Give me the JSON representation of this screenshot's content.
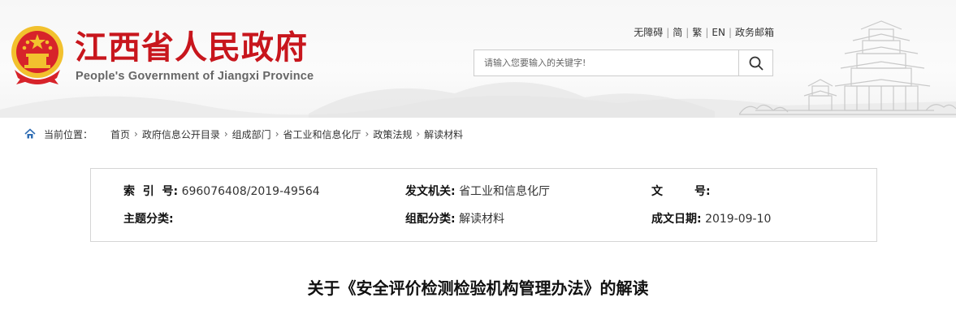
{
  "header": {
    "site_title": "江西省人民政府",
    "site_subtitle": "People's Government of Jiangxi Province",
    "top_links": [
      "无障碍",
      "简",
      "繁",
      "EN",
      "政务邮箱"
    ],
    "search": {
      "placeholder": "请输入您要输入的关键字!"
    }
  },
  "breadcrumb": {
    "label": "当前位置：",
    "items": [
      "首页",
      "政府信息公开目录",
      "组成部门",
      "省工业和信息化厅",
      "政策法规",
      "解读材料"
    ]
  },
  "meta": {
    "index_no_label": "索  引  号:",
    "index_no": "696076408/2019-49564",
    "issuer_label": "发文机关:",
    "issuer": "省工业和信息化厅",
    "doc_no_label": "文        号:",
    "doc_no": "",
    "topic_label": "主题分类:",
    "topic": "",
    "category_label": "组配分类:",
    "category": "解读材料",
    "date_label": "成文日期:",
    "date": "2019-09-10"
  },
  "article": {
    "title": "关于《安全评价检测检验机构管理办法》的解读"
  },
  "colors": {
    "brand_red": "#c8161d",
    "gold": "#f2c12e"
  }
}
